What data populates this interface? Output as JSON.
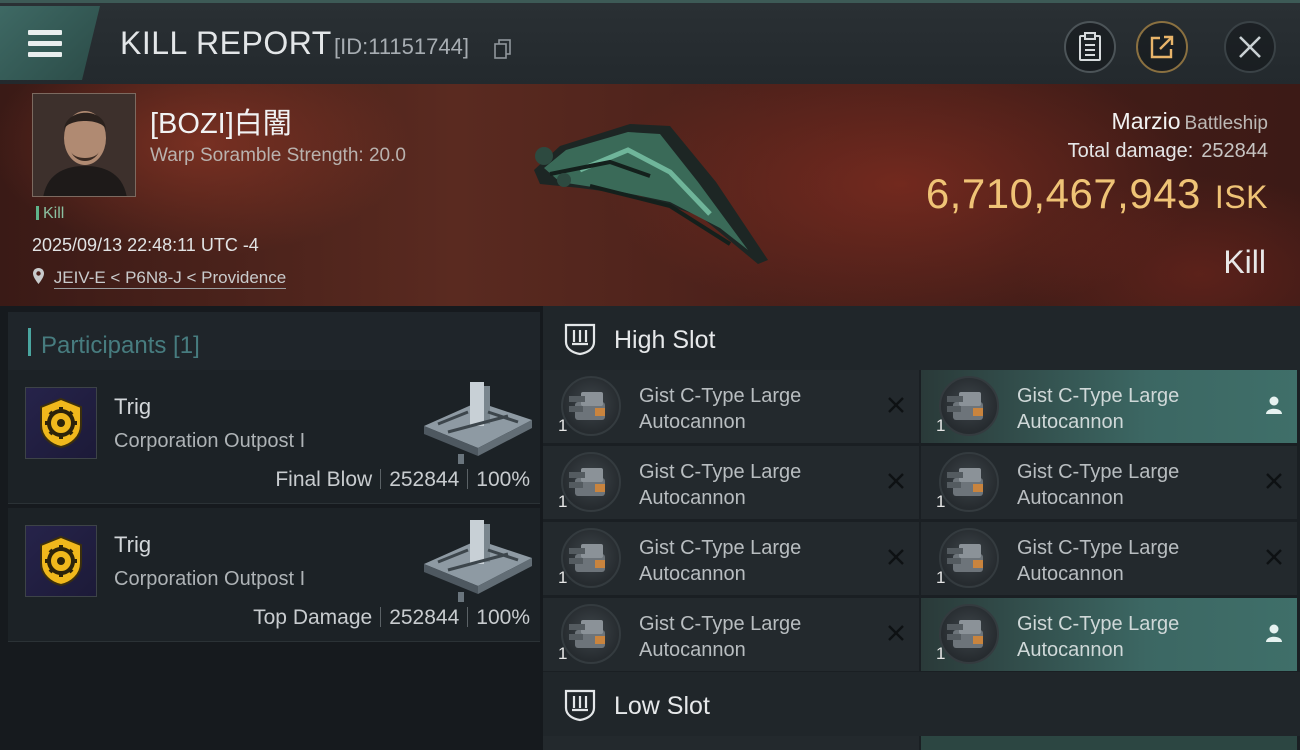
{
  "header": {
    "title": "KILL REPORT",
    "report_id": "[ID:11151744]"
  },
  "victim": {
    "name": "[BOZI]白闇",
    "subtitle": "Warp Soramble Strength: 20.0",
    "tag": "Kill",
    "datetime": "2025/09/13 22:48:11 UTC -4",
    "location": "JEIV-E < P6N8-J < Providence",
    "ship_name": "Marzio",
    "ship_class": "Battleship",
    "total_damage_label": "Total damage:",
    "total_damage": "252844",
    "isk_value": "6,710,467,943",
    "isk_unit": "ISK",
    "kill_type": "Kill"
  },
  "participants": {
    "label": "Participants [1]",
    "items": [
      {
        "pilot": "Trig",
        "corp": "Corporation Outpost I",
        "role": "Final Blow",
        "damage": "252844",
        "percent": "100%"
      },
      {
        "pilot": "Trig",
        "corp": "Corporation Outpost I",
        "role": "Top Damage",
        "damage": "252844",
        "percent": "100%"
      }
    ]
  },
  "slots": {
    "high_label": "High Slot",
    "low_label": "Low Slot",
    "high": [
      {
        "name1": "Gist C-Type Large",
        "name2": "Autocannon",
        "qty": "1",
        "state": "destroyed"
      },
      {
        "name1": "Gist C-Type Large",
        "name2": "Autocannon",
        "qty": "1",
        "state": "dropped"
      },
      {
        "name1": "Gist C-Type Large",
        "name2": "Autocannon",
        "qty": "1",
        "state": "destroyed"
      },
      {
        "name1": "Gist C-Type Large",
        "name2": "Autocannon",
        "qty": "1",
        "state": "destroyed"
      },
      {
        "name1": "Gist C-Type Large",
        "name2": "Autocannon",
        "qty": "1",
        "state": "destroyed"
      },
      {
        "name1": "Gist C-Type Large",
        "name2": "Autocannon",
        "qty": "1",
        "state": "destroyed"
      },
      {
        "name1": "Gist C-Type Large",
        "name2": "Autocannon",
        "qty": "1",
        "state": "destroyed"
      },
      {
        "name1": "Gist C-Type Large",
        "name2": "Autocannon",
        "qty": "1",
        "state": "dropped"
      }
    ]
  },
  "colors": {
    "accent_teal": "#3f6f69",
    "isk_gold": "#efc376",
    "banner_red": "#5a2a20"
  }
}
